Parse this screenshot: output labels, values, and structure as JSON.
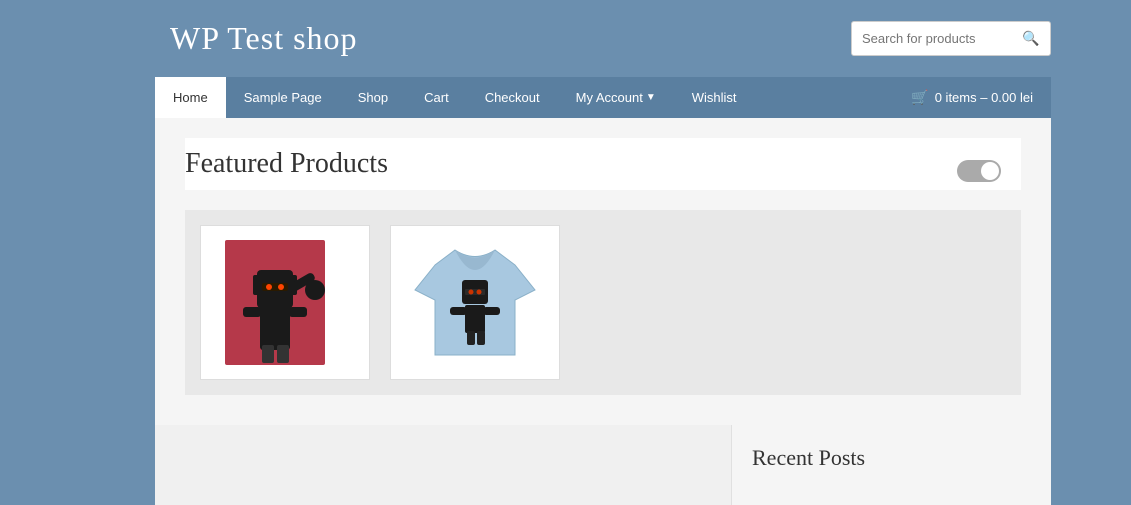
{
  "site": {
    "title": "WP Test shop"
  },
  "search": {
    "placeholder": "Search for products",
    "button_icon": "🔍"
  },
  "nav": {
    "items": [
      {
        "label": "Home",
        "active": true
      },
      {
        "label": "Sample Page",
        "active": false
      },
      {
        "label": "Shop",
        "active": false
      },
      {
        "label": "Cart",
        "active": false
      },
      {
        "label": "Checkout",
        "active": false
      },
      {
        "label": "My Account",
        "has_arrow": true,
        "active": false
      },
      {
        "label": "Wishlist",
        "active": false
      }
    ],
    "cart": {
      "label": "0 items – 0.00 lei"
    }
  },
  "featured": {
    "title": "Featured Products"
  },
  "products": [
    {
      "id": "ninja-poster",
      "alt": "Ninja poster product"
    },
    {
      "id": "tshirt",
      "alt": "T-shirt product"
    }
  ],
  "sidebar": {
    "recent_posts_title": "Recent Posts"
  }
}
